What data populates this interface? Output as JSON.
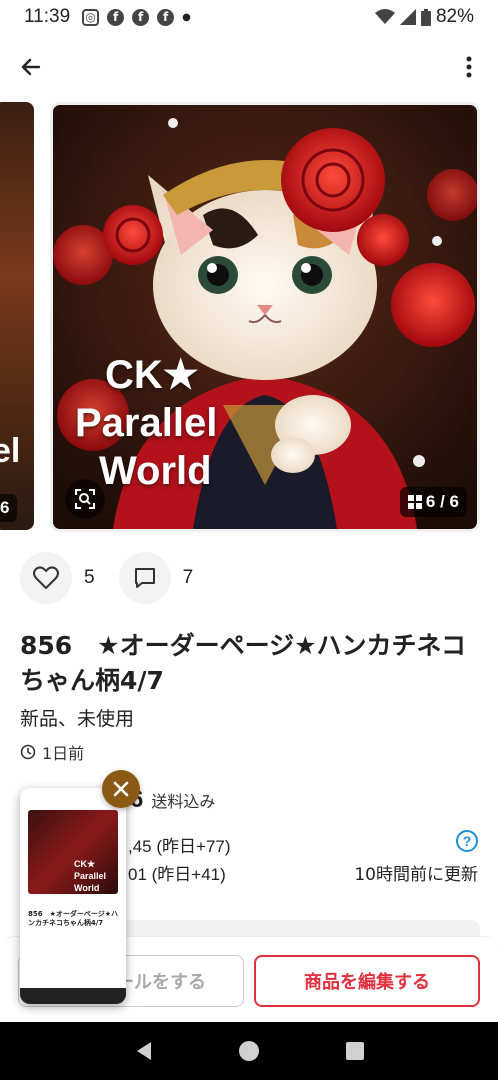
{
  "status_bar": {
    "time": "11:39",
    "notification_icons": [
      "instagram-icon",
      "facebook-icon",
      "facebook-icon",
      "facebook-icon",
      "dot-icon"
    ],
    "battery": "82%"
  },
  "gallery": {
    "image_text_line1": "CK★",
    "image_text_line2": "Parallel",
    "image_text_line3": "World",
    "counter": "6 / 6",
    "prev_counter": "6",
    "prev_text": "el"
  },
  "actions": {
    "likes": "5",
    "comments": "7"
  },
  "item": {
    "title": "856　★オーダーページ★ハンカチネコちゃん柄4/7",
    "condition": "新品、未使用",
    "posted": "1日前"
  },
  "price": {
    "value_partial": "6",
    "note": "送料込み",
    "stat1": ",45 (昨日+77)",
    "stat2": "01 (昨日+41)",
    "updated": "10時間前に更新"
  },
  "bottom_bar": {
    "promo_label": "ールをする",
    "edit_label": "商品を編集する"
  },
  "pip": {
    "title": "856　★オーダーページ★ハンカチネコちゃん柄4/7",
    "text": "CK★ Parallel World"
  },
  "colors": {
    "accent": "#e0323e",
    "help": "#1a8fd8",
    "pip_close": "#8a5a14"
  }
}
